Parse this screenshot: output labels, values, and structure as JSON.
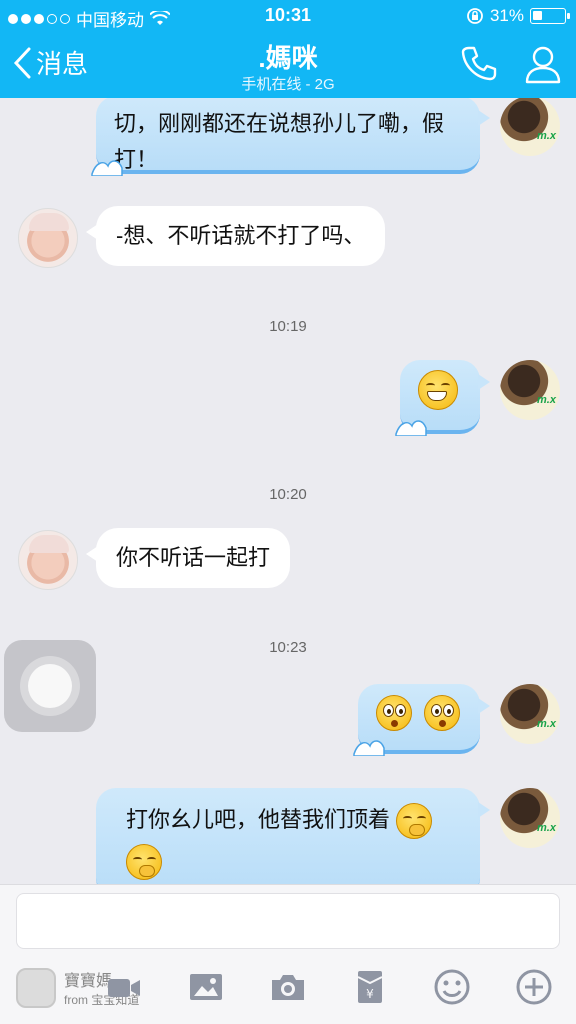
{
  "status_bar": {
    "carrier": "中国移动",
    "time": "10:31",
    "battery": "31%",
    "battery_level": 0.31
  },
  "nav": {
    "back_label": "消息",
    "title": ".媽咪",
    "subtitle": "手机在线 - 2G"
  },
  "messages": [
    {
      "side": "out",
      "text": "切，刚刚都还在说想孙儿了嘞，假打！"
    },
    {
      "side": "in",
      "text": "-想、不听话就不打了吗、"
    },
    {
      "time": "10:19"
    },
    {
      "side": "out",
      "emoji": [
        "grin-emoji"
      ]
    },
    {
      "time": "10:20"
    },
    {
      "side": "in",
      "text": "你不听话一起打"
    },
    {
      "time": "10:23"
    },
    {
      "side": "out",
      "emoji": [
        "surprised-emoji",
        "surprised-emoji"
      ]
    },
    {
      "side": "out",
      "text": "打你幺儿吧，他替我们顶着"
    }
  ],
  "avatar_tag": "m.x",
  "watermark": {
    "name": "寶寶媽",
    "from": "from 宝宝知道"
  },
  "colors": {
    "nav": "#12b7f5",
    "bubble_out": "#c8e5fa",
    "bubble_in": "#ffffff",
    "background": "#ebebf0"
  }
}
